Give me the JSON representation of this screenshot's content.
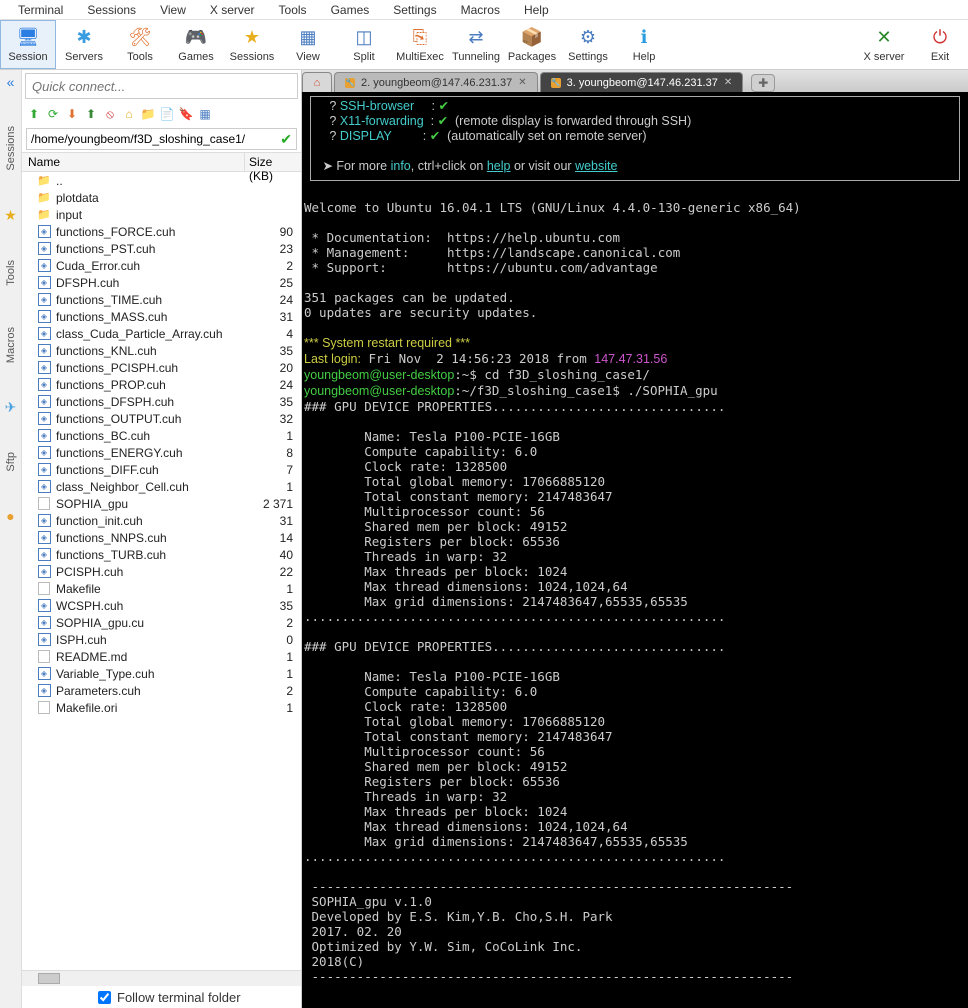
{
  "menubar": [
    "Terminal",
    "Sessions",
    "View",
    "X server",
    "Tools",
    "Games",
    "Settings",
    "Macros",
    "Help"
  ],
  "toolbar": [
    {
      "label": "Session",
      "glyph": "🖥",
      "sel": true,
      "color": "#2a7de1"
    },
    {
      "label": "Servers",
      "glyph": "✱",
      "color": "#3a9de1"
    },
    {
      "label": "Tools",
      "glyph": "🛠",
      "color": "#e07030"
    },
    {
      "label": "Games",
      "glyph": "🎮",
      "color": "#30a050"
    },
    {
      "label": "Sessions",
      "glyph": "★",
      "color": "#e8b020"
    },
    {
      "label": "View",
      "glyph": "▦",
      "color": "#4a7cc0"
    },
    {
      "label": "Split",
      "glyph": "◫",
      "color": "#4a7cc0"
    },
    {
      "label": "MultiExec",
      "glyph": "⎘",
      "color": "#e07030"
    },
    {
      "label": "Tunneling",
      "glyph": "⇄",
      "color": "#4a7cc0"
    },
    {
      "label": "Packages",
      "glyph": "📦",
      "color": "#888"
    },
    {
      "label": "Settings",
      "glyph": "⚙",
      "color": "#4a7cc0"
    },
    {
      "label": "Help",
      "glyph": "ℹ",
      "color": "#2a9de1"
    }
  ],
  "toolbar_right": [
    {
      "label": "X server",
      "glyph": "✕",
      "color": "#2a8a2a"
    },
    {
      "label": "Exit",
      "glyph": "⏻",
      "color": "#d03030"
    }
  ],
  "quick_placeholder": "Quick connect...",
  "left_tabs": [
    "Sessions",
    "Tools",
    "Macros",
    "Sftp"
  ],
  "path": "/home/youngbeom/f3D_sloshing_case1/",
  "file_headers": {
    "name": "Name",
    "size": "Size (KB)"
  },
  "files": [
    {
      "name": "..",
      "type": "up"
    },
    {
      "name": "plotdata",
      "type": "folder"
    },
    {
      "name": "input",
      "type": "folder"
    },
    {
      "name": "functions_FORCE.cuh",
      "type": "cuh",
      "size": "90"
    },
    {
      "name": "functions_PST.cuh",
      "type": "cuh",
      "size": "23"
    },
    {
      "name": "Cuda_Error.cuh",
      "type": "cuh",
      "size": "2"
    },
    {
      "name": "DFSPH.cuh",
      "type": "cuh",
      "size": "25"
    },
    {
      "name": "functions_TIME.cuh",
      "type": "cuh",
      "size": "24"
    },
    {
      "name": "functions_MASS.cuh",
      "type": "cuh",
      "size": "31"
    },
    {
      "name": "class_Cuda_Particle_Array.cuh",
      "type": "cuh",
      "size": "4"
    },
    {
      "name": "functions_KNL.cuh",
      "type": "cuh",
      "size": "35"
    },
    {
      "name": "functions_PCISPH.cuh",
      "type": "cuh",
      "size": "20"
    },
    {
      "name": "functions_PROP.cuh",
      "type": "cuh",
      "size": "24"
    },
    {
      "name": "functions_DFSPH.cuh",
      "type": "cuh",
      "size": "35"
    },
    {
      "name": "functions_OUTPUT.cuh",
      "type": "cuh",
      "size": "32"
    },
    {
      "name": "functions_BC.cuh",
      "type": "cuh",
      "size": "1"
    },
    {
      "name": "functions_ENERGY.cuh",
      "type": "cuh",
      "size": "8"
    },
    {
      "name": "functions_DIFF.cuh",
      "type": "cuh",
      "size": "7"
    },
    {
      "name": "class_Neighbor_Cell.cuh",
      "type": "cuh",
      "size": "1"
    },
    {
      "name": "SOPHIA_gpu",
      "type": "file",
      "size": "2 371"
    },
    {
      "name": "function_init.cuh",
      "type": "cuh",
      "size": "31"
    },
    {
      "name": "functions_NNPS.cuh",
      "type": "cuh",
      "size": "14"
    },
    {
      "name": "functions_TURB.cuh",
      "type": "cuh",
      "size": "40"
    },
    {
      "name": "PCISPH.cuh",
      "type": "cuh",
      "size": "22"
    },
    {
      "name": "Makefile",
      "type": "file",
      "size": "1"
    },
    {
      "name": "WCSPH.cuh",
      "type": "cuh",
      "size": "35"
    },
    {
      "name": "SOPHIA_gpu.cu",
      "type": "cu",
      "size": "2"
    },
    {
      "name": "ISPH.cuh",
      "type": "cuh",
      "size": "0"
    },
    {
      "name": "README.md",
      "type": "file",
      "size": "1"
    },
    {
      "name": "Variable_Type.cuh",
      "type": "cuh",
      "size": "1"
    },
    {
      "name": "Parameters.cuh",
      "type": "cuh",
      "size": "2"
    },
    {
      "name": "Makefile.ori",
      "type": "file",
      "size": "1"
    }
  ],
  "follow_label": "Follow terminal folder",
  "tabs": [
    {
      "label": "2. youngbeom@147.46.231.37",
      "active": false
    },
    {
      "label": "3. youngbeom@147.46.231.37",
      "active": true
    }
  ],
  "terminal": {
    "box": [
      {
        "p": "   ? ",
        "k": "SSH-browser",
        "c": "     : ",
        "ok": true
      },
      {
        "p": "   ? ",
        "k": "X11-forwarding",
        "c": "  : ",
        "ok": true,
        "r": "  (remote display is forwarded through SSH)"
      },
      {
        "p": "   ? ",
        "k": "DISPLAY",
        "c": "         : ",
        "ok": true,
        "r": "  (automatically set on remote server)"
      }
    ],
    "box_footer_pre": " ➤ For more ",
    "info": "info",
    "box_footer_mid": ", ctrl+click on ",
    "help": "help",
    "box_footer_mid2": " or visit our ",
    "website": "website",
    "welcome": "Welcome to Ubuntu 16.04.1 LTS (GNU/Linux 4.4.0-130-generic x86_64)",
    "docs": [
      " * Documentation:  https://help.ubuntu.com",
      " * Management:     https://landscape.canonical.com",
      " * Support:        https://ubuntu.com/advantage"
    ],
    "pkg1": "351 packages can be updated.",
    "pkg2": "0 updates are security updates.",
    "restart": "*** System restart required ***",
    "lastlogin_pre": "Last login:",
    "lastlogin_mid": " Fri Nov  2 14:56:23 2018 from ",
    "lastlogin_ip": "147.47.31.56",
    "prompt1_u": "youngbeom@user-desktop",
    "prompt1_p": ":~$",
    "prompt1_cmd": " cd f3D_sloshing_case1/",
    "prompt2_u": "youngbeom@user-desktop",
    "prompt2_p": ":~/f3D_sloshing_case1$",
    "prompt2_cmd": " ./SOPHIA_gpu",
    "gpu_hdr": "### GPU DEVICE PROPERTIES...............................",
    "gpu": [
      "        Name: Tesla P100-PCIE-16GB",
      "        Compute capability: 6.0",
      "        Clock rate: 1328500",
      "        Total global memory: 17066885120",
      "        Total constant memory: 2147483647",
      "        Multiprocessor count: 56",
      "        Shared mem per block: 49152",
      "        Registers per block: 65536",
      "        Threads in warp: 32",
      "        Max threads per block: 1024",
      "        Max thread dimensions: 1024,1024,64",
      "        Max grid dimensions: 2147483647,65535,65535"
    ],
    "dots": "........................................................",
    "dash": "----------------------------------------------------------------",
    "footer": [
      " SOPHIA_gpu v.1.0",
      " Developed by E.S. Kim,Y.B. Cho,S.H. Park",
      " 2017. 02. 20",
      " Optimized by Y.W. Sim, CoCoLink Inc.",
      " 2018(C)"
    ]
  }
}
